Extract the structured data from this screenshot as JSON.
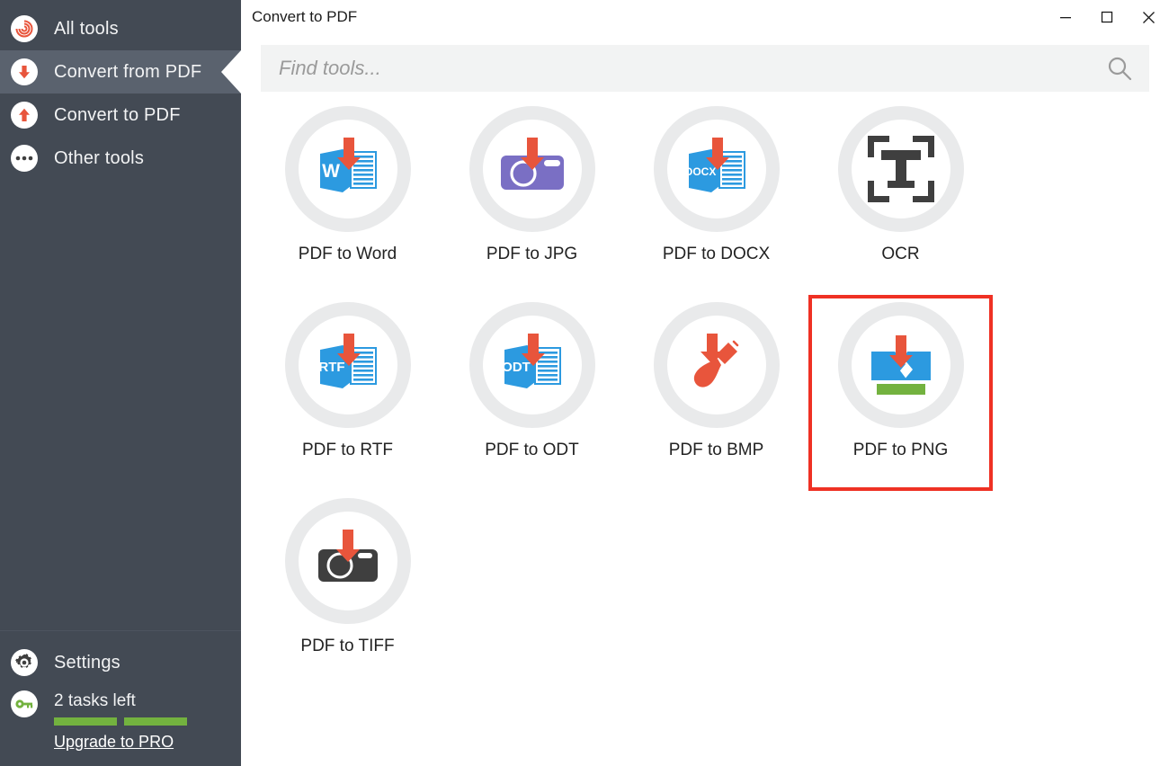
{
  "sidebar": {
    "items": [
      {
        "label": "All tools",
        "icon": "spiral-icon",
        "active": false
      },
      {
        "label": "Convert from PDF",
        "icon": "arrow-down-icon",
        "active": true
      },
      {
        "label": "Convert to PDF",
        "icon": "arrow-up-icon",
        "active": false
      },
      {
        "label": "Other tools",
        "icon": "ellipsis-icon",
        "active": false
      }
    ],
    "settings_label": "Settings",
    "settings_icon": "gear-icon",
    "tasks_label": "2 tasks left",
    "tasks_icon": "key-icon",
    "upgrade_label": "Upgrade to PRO",
    "progress_segments": 2,
    "progress_color": "#73b23f",
    "background_color": "#434a54",
    "active_background_color": "#5a626e"
  },
  "titlebar": {
    "title": "Convert to PDF",
    "minimize_label": "–",
    "maximize_label": "☐",
    "close_label": "✕"
  },
  "search": {
    "placeholder": "Find tools...",
    "value": "",
    "icon": "search-icon"
  },
  "tools": [
    {
      "label": "PDF to Word",
      "icon": "pdf-to-word-icon",
      "selected": false
    },
    {
      "label": "PDF to JPG",
      "icon": "pdf-to-jpg-icon",
      "selected": false
    },
    {
      "label": "PDF to DOCX",
      "icon": "pdf-to-docx-icon",
      "selected": false
    },
    {
      "label": "OCR",
      "icon": "ocr-icon",
      "selected": false
    },
    {
      "label": "PDF to RTF",
      "icon": "pdf-to-rtf-icon",
      "selected": false
    },
    {
      "label": "PDF to ODT",
      "icon": "pdf-to-odt-icon",
      "selected": false
    },
    {
      "label": "PDF to BMP",
      "icon": "pdf-to-bmp-icon",
      "selected": false
    },
    {
      "label": "PDF to PNG",
      "icon": "pdf-to-png-icon",
      "selected": true
    },
    {
      "label": "PDF to TIFF",
      "icon": "pdf-to-tiff-icon",
      "selected": false
    }
  ],
  "colors": {
    "accent_red": "#e8553c",
    "doc_blue": "#2c9ae0",
    "purple": "#7a6fc4",
    "green": "#73b23f",
    "dark_gray": "#3f3f3f",
    "selection_red": "#ef3124",
    "ring_gray": "#e9eaeb"
  }
}
